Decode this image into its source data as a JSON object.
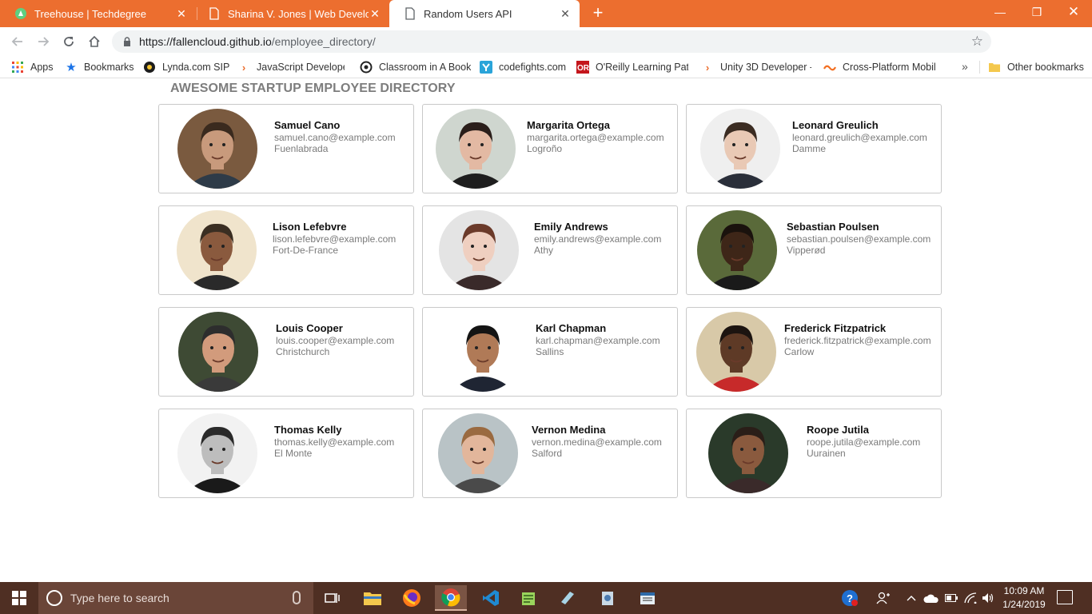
{
  "browser": {
    "tabs": [
      {
        "title": "Treehouse | Techdegree",
        "icon": "treehouse-icon"
      },
      {
        "title": "Sharina V. Jones | Web Developer",
        "icon": "page-icon"
      },
      {
        "title": "Random Users API",
        "icon": "page-icon",
        "active": true
      }
    ],
    "url_host": "https://fallencloud.github.io",
    "url_path": "/employee_directory/",
    "bookmarks": [
      {
        "label": "Apps",
        "icon": "apps-grid-icon"
      },
      {
        "label": "Bookmarks",
        "icon": "star-icon"
      },
      {
        "label": "Lynda.com SIP",
        "icon": "lynda-icon"
      },
      {
        "label": "JavaScript Developer",
        "icon": "treehouse-bookmark-icon"
      },
      {
        "label": "Classroom in A Book",
        "icon": "classroom-icon"
      },
      {
        "label": "codefights.com",
        "icon": "codefights-icon"
      },
      {
        "label": "O'Reilly Learning Path",
        "icon": "oreilly-icon"
      },
      {
        "label": "Unity 3D Developer -",
        "icon": "treehouse-bookmark-icon"
      },
      {
        "label": "Cross-Platform Mobil",
        "icon": "wave-icon"
      }
    ],
    "other_bookmarks": "Other bookmarks",
    "overflow": "»"
  },
  "page": {
    "heading": "AWESOME STARTUP EMPLOYEE DIRECTORY",
    "employees": [
      {
        "name": "Samuel Cano",
        "email": "samuel.cano@example.com",
        "city": "Fuenlabrada",
        "skin": "#c89a7c",
        "hair": "#3a2a1e",
        "bg": "#7a5a3f",
        "shirt": "#2e3b48"
      },
      {
        "name": "Margarita Ortega",
        "email": "margarita.ortega@example.com",
        "city": "Logroño",
        "skin": "#e3b9a3",
        "hair": "#2a1e1a",
        "bg": "#cfd6cf",
        "shirt": "#1e1e1e"
      },
      {
        "name": "Leonard Greulich",
        "email": "leonard.greulich@example.com",
        "city": "Damme",
        "skin": "#e9c9b5",
        "hair": "#3b2c22",
        "bg": "#efefef",
        "shirt": "#2a2f3a"
      },
      {
        "name": "Lison Lefebvre",
        "email": "lison.lefebvre@example.com",
        "city": "Fort-De-France",
        "skin": "#8a5a3e",
        "hair": "#3a2e22",
        "bg": "#f0e4cc",
        "shirt": "#2a2a2a"
      },
      {
        "name": "Emily Andrews",
        "email": "emily.andrews@example.com",
        "city": "Athy",
        "skin": "#efcfc0",
        "hair": "#6b3a2a",
        "bg": "#e4e4e4",
        "shirt": "#3a2a2a"
      },
      {
        "name": "Sebastian Poulsen",
        "email": "sebastian.poulsen@example.com",
        "city": "Vipperød",
        "skin": "#3e2618",
        "hair": "#1a120d",
        "bg": "#5a6a3a",
        "shirt": "#1a1a1a"
      },
      {
        "name": "Louis Cooper",
        "email": "louis.cooper@example.com",
        "city": "Christchurch",
        "skin": "#d29b7c",
        "hair": "#2d2d2d",
        "bg": "#3e4a34",
        "shirt": "#3a3a3a"
      },
      {
        "name": "Karl Chapman",
        "email": "karl.chapman@example.com",
        "city": "Sallins",
        "skin": "#b07a57",
        "hair": "#141414",
        "bg": "#ffffff",
        "shirt": "#1f2533"
      },
      {
        "name": "Frederick Fitzpatrick",
        "email": "frederick.fitzpatrick@example.com",
        "city": "Carlow",
        "skin": "#5e3a26",
        "hair": "#1c1410",
        "bg": "#d8c9a8",
        "shirt": "#c72a2a"
      },
      {
        "name": "Thomas Kelly",
        "email": "thomas.kelly@example.com",
        "city": "El Monte",
        "skin": "#bdbdbd",
        "hair": "#2a2a2a",
        "bg": "#f2f2f2",
        "shirt": "#1a1a1a"
      },
      {
        "name": "Vernon Medina",
        "email": "vernon.medina@example.com",
        "city": "Salford",
        "skin": "#e2b69b",
        "hair": "#9a6a40",
        "bg": "#b9c3c6",
        "shirt": "#4a4a4a"
      },
      {
        "name": "Roope Jutila",
        "email": "roope.jutila@example.com",
        "city": "Uurainen",
        "skin": "#8a5a3e",
        "hair": "#2a1e18",
        "bg": "#2a3a2a",
        "shirt": "#3a2a2a"
      }
    ]
  },
  "taskbar": {
    "search_placeholder": "Type here to search",
    "time": "10:09 AM",
    "date": "1/24/2019",
    "apps": [
      "task-view-icon",
      "file-explorer-icon",
      "firefox-icon",
      "chrome-icon",
      "vscode-icon",
      "notepad-plus-icon",
      "app-icon",
      "app-icon",
      "app-icon"
    ]
  },
  "colors": {
    "accent": "#ec6e2f",
    "taskbar": "#4f2f23"
  }
}
